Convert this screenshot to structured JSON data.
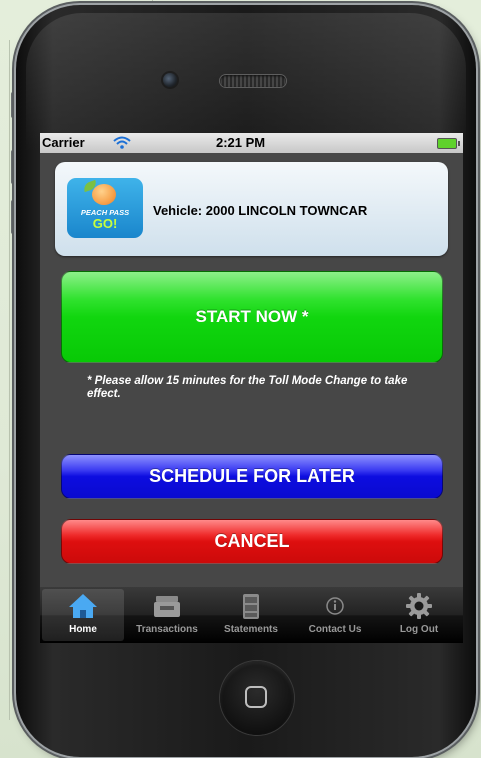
{
  "statusbar": {
    "carrier": "Carrier",
    "time": "2:21 PM",
    "icons": [
      "wifi-icon",
      "battery-icon"
    ]
  },
  "vehicle": {
    "label": "Vehicle: 2000 LINCOLN TOWNCAR",
    "logo_line1": "PEACH PASS",
    "logo_line2": "GO!"
  },
  "buttons": {
    "start": "START NOW *",
    "schedule": "SCHEDULE FOR LATER",
    "cancel": "CANCEL"
  },
  "note": "* Please allow 15 minutes for the Toll Mode Change to take effect.",
  "tabs": [
    {
      "label": "Home",
      "icon": "home-icon",
      "active": true
    },
    {
      "label": "Transactions",
      "icon": "inbox-tray-icon",
      "active": false
    },
    {
      "label": "Statements",
      "icon": "file-cabinet-icon",
      "active": false
    },
    {
      "label": "Contact Us",
      "icon": "info-icon",
      "active": false
    },
    {
      "label": "Log Out",
      "icon": "gear-icon",
      "active": false
    }
  ],
  "colors": {
    "start": "#11d60f",
    "schedule": "#0d0de0",
    "cancel": "#de0f0f",
    "screen_bg": "#474747",
    "page_bg": "#e4eedb"
  }
}
